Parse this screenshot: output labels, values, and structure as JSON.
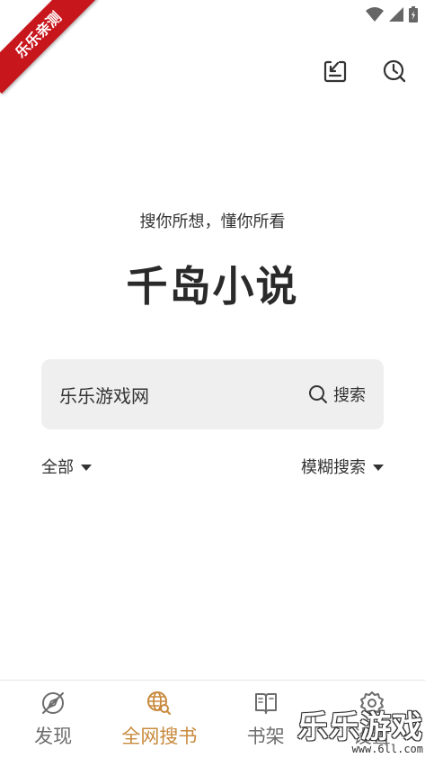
{
  "ribbon": {
    "text": "乐乐亲测"
  },
  "colors": {
    "accent": "#c8893c",
    "ribbon": "#c8161d",
    "search_bg": "#efefef",
    "text": "#333333"
  },
  "status_bar": {
    "icons": [
      "wifi-icon",
      "signal-icon",
      "battery-icon"
    ]
  },
  "toolbar": {
    "actions": [
      "import-icon",
      "history-icon"
    ]
  },
  "slogan": "搜你所想，懂你所看",
  "app_title": "千岛小说",
  "search": {
    "value": "乐乐游戏网",
    "button_label": "搜索"
  },
  "filters": {
    "scope": "全部",
    "mode": "模糊搜索"
  },
  "nav": {
    "items": [
      {
        "label": "发现",
        "icon": "compass-icon",
        "active": false
      },
      {
        "label": "全网搜书",
        "icon": "globe-search-icon",
        "active": true
      },
      {
        "label": "书架",
        "icon": "book-icon",
        "active": false
      },
      {
        "label": "设置",
        "icon": "gear-icon",
        "active": false
      }
    ]
  },
  "watermark": {
    "text": "乐乐游戏",
    "url": "www.6ll.com"
  }
}
